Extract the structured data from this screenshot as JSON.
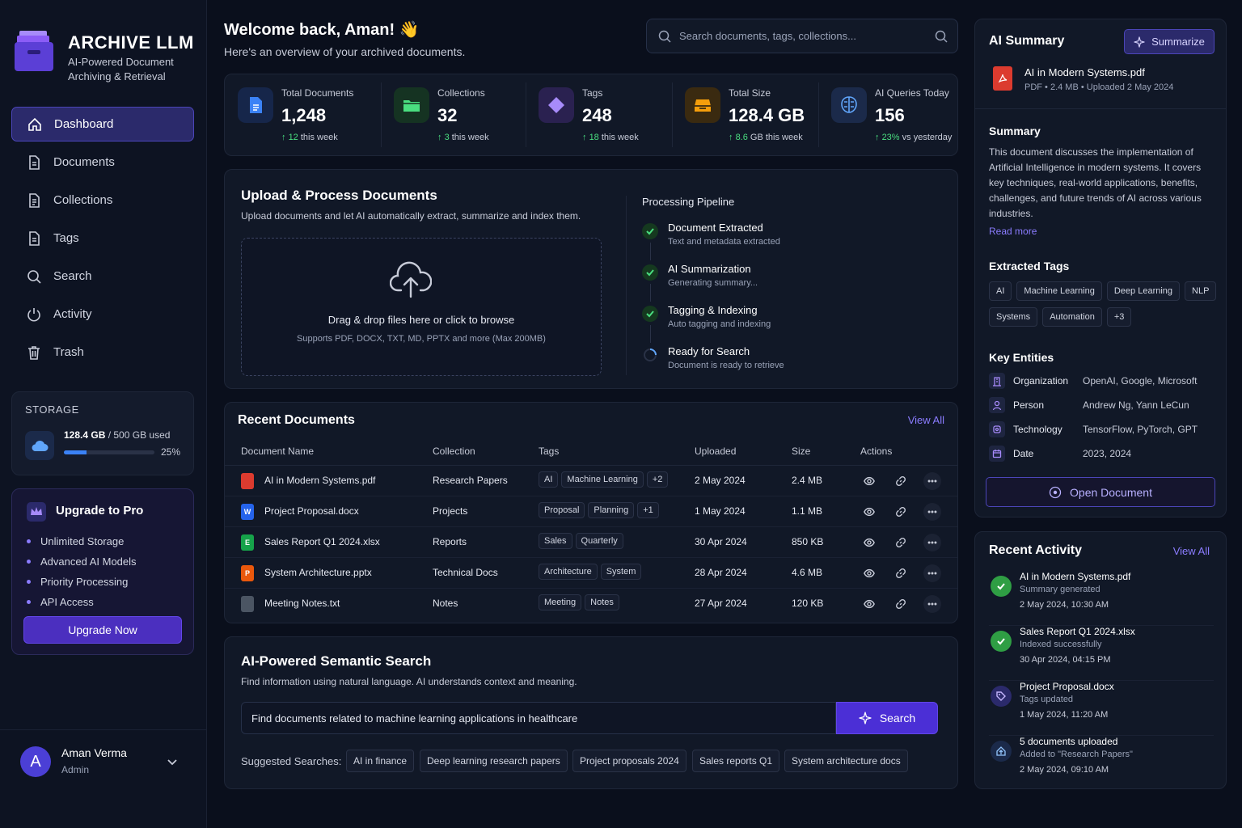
{
  "brand": {
    "title": "ARCHIVE LLM",
    "subtitle": "AI-Powered Document Archiving & Retrieval"
  },
  "nav": [
    {
      "label": "Dashboard",
      "icon": "home-icon",
      "active": true
    },
    {
      "label": "Documents",
      "icon": "document-icon"
    },
    {
      "label": "Collections",
      "icon": "collection-icon"
    },
    {
      "label": "Tags",
      "icon": "tag-icon"
    },
    {
      "label": "Search",
      "icon": "search-icon"
    },
    {
      "label": "Activity",
      "icon": "power-icon"
    },
    {
      "label": "Trash",
      "icon": "trash-icon"
    }
  ],
  "storage": {
    "label": "STORAGE",
    "used": "128.4 GB",
    "total": "/ 500 GB used",
    "percent_label": "25%",
    "percent": 25
  },
  "pro": {
    "title": "Upgrade to Pro",
    "features": [
      "Unlimited Storage",
      "Advanced AI Models",
      "Priority Processing",
      "API Access"
    ],
    "button": "Upgrade Now"
  },
  "user": {
    "initial": "A",
    "name": "Aman Verma",
    "role": "Admin"
  },
  "header": {
    "welcome": "Welcome back, Aman!",
    "wave": "👋",
    "overview": "Here's an overview of your archived documents.",
    "search_placeholder": "Search documents, tags, collections..."
  },
  "stats": [
    {
      "label": "Total Documents",
      "value": "1,248",
      "delta": "12",
      "delta_text": "this week",
      "color": "#3b82f6",
      "bg": "#16264a"
    },
    {
      "label": "Collections",
      "value": "32",
      "delta": "3",
      "delta_text": "this week",
      "color": "#4ade80",
      "bg": "#153322"
    },
    {
      "label": "Tags",
      "value": "248",
      "delta": "18",
      "delta_text": "this week",
      "color": "#a78bfa",
      "bg": "#2a2150"
    },
    {
      "label": "Total Size",
      "value": "128.4 GB",
      "delta": "8.6",
      "delta_text": "GB this week",
      "color": "#f59e0b",
      "bg": "#3a2a10"
    },
    {
      "label": "AI Queries Today",
      "value": "156",
      "delta": "23%",
      "delta_text": "vs yesterday",
      "color": "#60a5fa",
      "bg": "#1b2a4a"
    }
  ],
  "upload": {
    "title": "Upload & Process Documents",
    "desc": "Upload documents and let AI automatically extract, summarize and index them.",
    "drop_text": "Drag & drop files here or click to browse",
    "drop_sub": "Supports PDF, DOCX, TXT, MD, PPTX and more (Max 200MB)",
    "pipeline_title": "Processing Pipeline",
    "steps": [
      {
        "title": "Document Extracted",
        "sub": "Text and metadata extracted",
        "status": "done"
      },
      {
        "title": "AI Summarization",
        "sub": "Generating summary...",
        "status": "done"
      },
      {
        "title": "Tagging & Indexing",
        "sub": "Auto tagging and indexing",
        "status": "done"
      },
      {
        "title": "Ready for Search",
        "sub": "Document is ready to retrieve",
        "status": "loading"
      }
    ]
  },
  "recent": {
    "title": "Recent Documents",
    "view_all": "View All",
    "columns": [
      "Document Name",
      "Collection",
      "Tags",
      "Uploaded",
      "Size",
      "Actions"
    ],
    "rows": [
      {
        "name": "AI in Modern Systems.pdf",
        "type": "pdf",
        "collection": "Research Papers",
        "tags": [
          "AI",
          "Machine Learning",
          "+2"
        ],
        "uploaded": "2 May 2024",
        "size": "2.4 MB"
      },
      {
        "name": "Project Proposal.docx",
        "type": "docx",
        "collection": "Projects",
        "tags": [
          "Proposal",
          "Planning",
          "+1"
        ],
        "uploaded": "1 May 2024",
        "size": "1.1 MB"
      },
      {
        "name": "Sales Report Q1 2024.xlsx",
        "type": "xlsx",
        "collection": "Reports",
        "tags": [
          "Sales",
          "Quarterly"
        ],
        "uploaded": "30 Apr 2024",
        "size": "850 KB"
      },
      {
        "name": "System Architecture.pptx",
        "type": "pptx",
        "collection": "Technical Docs",
        "tags": [
          "Architecture",
          "System"
        ],
        "uploaded": "28 Apr 2024",
        "size": "4.6 MB"
      },
      {
        "name": "Meeting Notes.txt",
        "type": "txt",
        "collection": "Notes",
        "tags": [
          "Meeting",
          "Notes"
        ],
        "uploaded": "27 Apr 2024",
        "size": "120 KB"
      }
    ]
  },
  "semantic": {
    "title": "AI-Powered Semantic Search",
    "desc": "Find information using natural language. AI understands context and meaning.",
    "query": "Find documents related to machine learning applications in healthcare",
    "button": "Search",
    "suggest_label": "Suggested Searches:",
    "suggestions": [
      "AI in finance",
      "Deep learning research papers",
      "Project proposals 2024",
      "Sales reports Q1",
      "System architecture docs"
    ]
  },
  "ai_summary": {
    "title": "AI Summary",
    "button": "Summarize",
    "file_name": "AI in Modern Systems.pdf",
    "file_meta": "PDF  •  2.4 MB  •  Uploaded 2 May 2024",
    "summary_heading": "Summary",
    "summary": "This document discusses the implementation of Artificial Intelligence in modern systems. It covers key techniques, real-world applications, benefits, challenges, and future trends of AI across various industries.",
    "read_more": "Read more",
    "tags_heading": "Extracted Tags",
    "tags": [
      "AI",
      "Machine Learning",
      "Deep Learning",
      "NLP",
      "Systems",
      "Automation",
      "+3"
    ],
    "entities_heading": "Key Entities",
    "entities": [
      {
        "key": "Organization",
        "value": "OpenAI, Google, Microsoft",
        "icon": "building-icon"
      },
      {
        "key": "Person",
        "value": "Andrew Ng, Yann LeCun",
        "icon": "person-icon"
      },
      {
        "key": "Technology",
        "value": "TensorFlow, PyTorch, GPT",
        "icon": "chip-icon"
      },
      {
        "key": "Date",
        "value": "2023, 2024",
        "icon": "calendar-icon"
      }
    ],
    "open_button": "Open Document"
  },
  "activity": {
    "title": "Recent Activity",
    "view_all": "View All",
    "items": [
      {
        "title": "AI in Modern Systems.pdf",
        "sub": "Summary generated",
        "time": "2 May 2024, 10:30 AM",
        "kind": "check"
      },
      {
        "title": "Sales Report Q1 2024.xlsx",
        "sub": "Indexed successfully",
        "time": "30 Apr 2024, 04:15 PM",
        "kind": "check"
      },
      {
        "title": "Project Proposal.docx",
        "sub": "Tags updated",
        "time": "1 May 2024, 11:20 AM",
        "kind": "tag"
      },
      {
        "title": "5 documents uploaded",
        "sub": "Added to \"Research Papers\"",
        "time": "2 May 2024, 09:10 AM",
        "kind": "upload"
      }
    ]
  }
}
